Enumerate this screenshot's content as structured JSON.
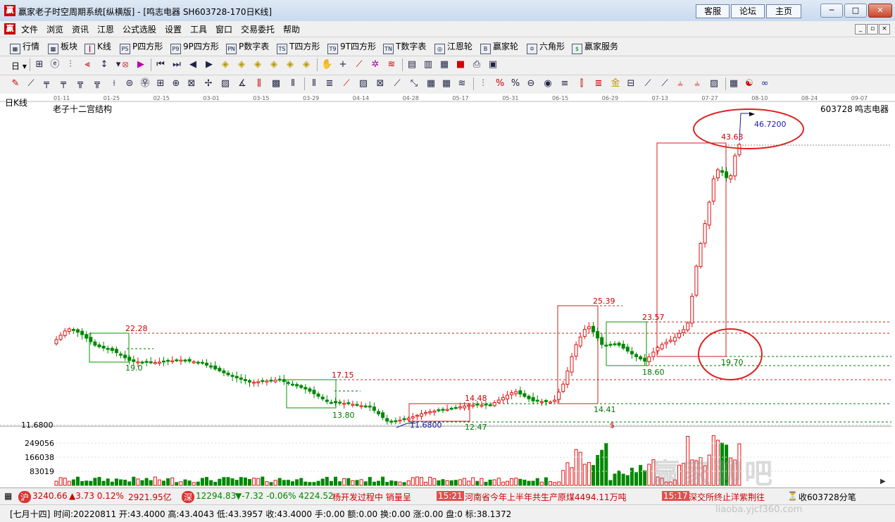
{
  "window": {
    "title": "赢家老子时空周期系统[纵横版] - [鸣志电器  SH603728-170日K线]",
    "links": [
      "客服",
      "论坛",
      "主页"
    ],
    "controls": {
      "minimize": "─",
      "restore": "□",
      "close": "✕"
    }
  },
  "menu": {
    "items": [
      "文件",
      "浏览",
      "资讯",
      "江恩",
      "公式选股",
      "设置",
      "工具",
      "窗口",
      "交易委托",
      "帮助"
    ],
    "mdi": {
      "minimize": "_",
      "restore": "▫",
      "close": "×"
    }
  },
  "toolbar1": {
    "items": [
      {
        "icon": "grid-icon",
        "label": "行情"
      },
      {
        "icon": "blocks-icon",
        "label": "板块"
      },
      {
        "icon": "candlestick-icon",
        "label": "K线"
      },
      {
        "icon": "ps-icon",
        "glyph": "PS",
        "label": "P四方形"
      },
      {
        "icon": "p9-icon",
        "glyph": "P9",
        "label": "9P四方形"
      },
      {
        "icon": "pn-icon",
        "glyph": "PN",
        "label": "P数字表"
      },
      {
        "icon": "ts-icon",
        "glyph": "TS",
        "label": "T四方形"
      },
      {
        "icon": "t9-icon",
        "glyph": "T9",
        "label": "9T四方形"
      },
      {
        "icon": "tn-icon",
        "glyph": "TN",
        "label": "T数字表"
      },
      {
        "icon": "gann-wheel-icon",
        "glyph": "◎",
        "label": "江恩轮"
      },
      {
        "icon": "big-wheel-icon",
        "glyph": "B",
        "label": "赢家轮"
      },
      {
        "icon": "hexagon-icon",
        "glyph": "✡",
        "label": "六角形"
      },
      {
        "icon": "dollar-icon",
        "glyph": "$",
        "label": "赢家服务"
      }
    ]
  },
  "toolbar2": {
    "dropdown_label": "日"
  },
  "chart": {
    "period_label": "日K线",
    "title": "老子十二宫结构",
    "stock_code": "603728",
    "stock_name": "鸣志电器",
    "dates": [
      "01-11",
      "01-25",
      "02-15",
      "03-01",
      "03-15",
      "03-29",
      "04-14",
      "04-28",
      "05-17",
      "05-31",
      "06-15",
      "06-29",
      "07-13",
      "07-27",
      "08-10",
      "08-24",
      "09-07"
    ],
    "price_axis_low_label": "11.6800",
    "volume_axis_labels": [
      "249056",
      "166038",
      "83019"
    ],
    "price_labels": {
      "p22_28": "22.28",
      "p19_0": "19.0",
      "p17_15": "17.15",
      "p13_80": "13.80",
      "p11_68": "11.6800",
      "p14_48": "14.48",
      "p12_47": "12.47",
      "p25_39": "25.39",
      "p14_41": "14.41",
      "p23_57": "23.57",
      "p18_60": "18.60",
      "p43_63": "43.63",
      "p46_72": "46.7200",
      "p19_70": "19.70",
      "dollar": "$"
    },
    "colors": {
      "up": "#e01010",
      "down": "#008800",
      "level_red": "#cc0000",
      "level_green": "#007700",
      "ellipse": "#dd2222",
      "label_blue": "#1a1aaa"
    }
  },
  "chart_data": {
    "type": "candlestick",
    "title": "老子十二宫结构",
    "xlabel": "",
    "ylabel": "",
    "x_ticks": [
      "01-11",
      "01-25",
      "02-15",
      "03-01",
      "03-15",
      "03-29",
      "04-14",
      "04-28",
      "05-17",
      "05-31",
      "06-15",
      "06-29",
      "07-13",
      "07-27",
      "08-10",
      "08-24",
      "09-07"
    ],
    "price_range": [
      11.68,
      46.72
    ],
    "key_levels": [
      22.28,
      17.15,
      14.48,
      25.39,
      14.41,
      23.57,
      19.7,
      43.63
    ],
    "marked_lows": [
      11.68,
      12.47,
      13.8,
      18.6
    ],
    "marked_high": 46.72,
    "last_close": 43.4
  },
  "status1": {
    "sh_index": "3240.66",
    "sh_change": "▲3.73 0.12%",
    "sh_amount": "2921.95亿",
    "sz_index": "12294.83",
    "sz_change": "▼-7.32 -0.06%",
    "sz_amount": "4224.52",
    "news": [
      {
        "time": "",
        "text": "杨开发过程中 销量呈"
      },
      {
        "time": "15:21",
        "text": "河南省今年上半年共生产原煤4494.11万吨"
      },
      {
        "time": "15:17",
        "text": "深交所终止洋紫荆往"
      }
    ],
    "trade_info": "收603728分笔"
  },
  "status2": {
    "lunar": "[七月十四]",
    "text": "时间:20220811 开:43.4000 高:43.4043 低:43.3957 收:43.4000 手:0.00 额:0.00 换:0.00 涨:0.00 盘:0 标:38.1372"
  },
  "watermark": {
    "main": "赢家聊吧",
    "sub": "liaoba.yjcf360.com"
  }
}
